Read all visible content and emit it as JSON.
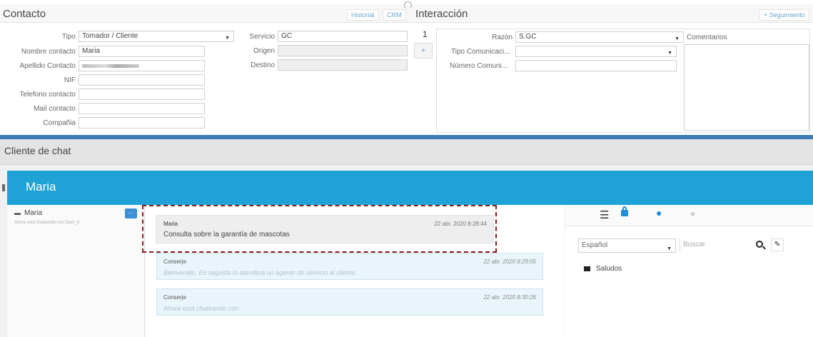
{
  "contacto": {
    "title": "Contacto",
    "historial": "Historial",
    "crm": "CRM",
    "tipo_label": "Tipo",
    "tipo_value": "Tomador / Cliente",
    "nombre_label": "Nombre contacto",
    "nombre_value": "Maria",
    "apellido_label": "Apellido Contacto",
    "nif_label": "NIF",
    "telefono_label": "Telefono contacto",
    "mail_label": "Mail contacto",
    "compania_label": "Compañia",
    "servicio_label": "Servicio",
    "servicio_value": "GC",
    "origen_label": "Origen",
    "destino_label": "Destino"
  },
  "interaccion": {
    "title": "Interacción",
    "seguimiento": "+ Seguimiento",
    "counter": "1",
    "plus": "+",
    "razon_label": "Razón",
    "razon_value": "S.GC",
    "tipo_comunicacion_label": "Tipo Comunicaci...",
    "numero_comunicacion_label": "Número Comuni...",
    "comentarios_label": "Comentarios"
  },
  "chat": {
    "section_title": "Cliente de chat",
    "contact_name": "Maria",
    "sidebar": {
      "name": "Maria",
      "status": "Ahora está chateando con Dani_S",
      "badge": "···"
    },
    "messages": [
      {
        "author": "Maria",
        "time": "22 abr. 2020 8:28:44",
        "text": "Consulta sobre la garantía de mascotas"
      },
      {
        "author": "Conserje",
        "time": "22 abr. 2020 8:29:05",
        "text": "Bienvenido. En seguida lo atenderá un agente de servicio al cliente."
      },
      {
        "author": "Conserje",
        "time": "22 abr. 2020 8:30:26",
        "text": "Ahora está chateando con"
      }
    ],
    "right_panel": {
      "language": "Español",
      "search_placeholder": "Buscar",
      "folder": "Saludos"
    }
  },
  "colors": {
    "header_blue": "#1fa2d6",
    "divider_blue": "#3b7cb8",
    "highlight_border": "#8b1a1a"
  },
  "icons": [
    "list-icon",
    "lock-icon",
    "users-icon",
    "chat-bubbles-icon",
    "search-icon",
    "eraser-icon",
    "folder-icon",
    "speech-bubble-icon"
  ]
}
